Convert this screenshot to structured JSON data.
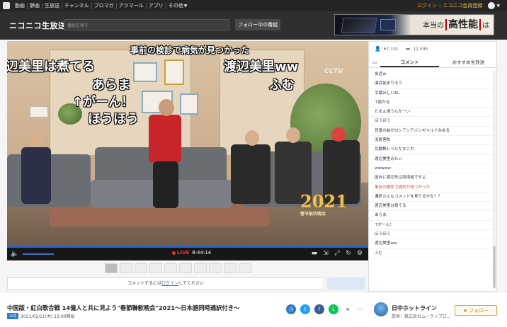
{
  "topnav": {
    "items": [
      "動画",
      "静画",
      "生放送",
      "チャンネル",
      "ブロマガ",
      "アツマール",
      "アプリ",
      "その他"
    ],
    "login": "ログイン",
    "register": "ニコニコ会員登録"
  },
  "header": {
    "brand": "ニコニコ生放送",
    "search_placeholder": "番組を探す",
    "follow_programs": "フォロー中の番組",
    "ad_text_prefix": "本当の",
    "ad_text_big": "高性能",
    "ad_text_suffix": "は"
  },
  "player": {
    "overlay_comments": [
      {
        "text": "事前の検診で病気が見つかった",
        "size": "small"
      },
      {
        "text": "辺美里は煮てる",
        "size": "big"
      },
      {
        "text": "渡辺美里ww",
        "size": "big"
      },
      {
        "text": "あらま",
        "size": "big"
      },
      {
        "text": "ふむ",
        "size": "big"
      },
      {
        "text": "↑がーん！",
        "size": "big"
      },
      {
        "text": "ほうほう",
        "size": "big"
      }
    ],
    "watermark": "CCTV",
    "logo_year": "2021",
    "logo_sub": "春节联欢晚会",
    "live_label": "LIVE",
    "time": "8:44:14",
    "volume_level": 0.55,
    "progress_level": 1.0
  },
  "comment_form": {
    "prefix": "コメントするには",
    "login_link": "ログイン",
    "suffix": "してください"
  },
  "panel": {
    "viewers": "67,101",
    "comments": "11,595",
    "tab_comment": "コメント",
    "tab_recommend": "おすすめ生放送",
    "comments_list": [
      "友近ｗ",
      "演武始まりそう",
      "字幕ほしいね。",
      "↑助かる",
      "たまよ遠うんかーい",
      "ほうほう",
      "背景の絵がロシアンアバンギャルドみある",
      "泡匿害防",
      "北朝鮮レベルだなこれ",
      "渡辺美里みたい",
      "wwwww",
      "因みに渡辺先は渤海省ですよ",
      "事前の検診で病気が見つかった",
      "通訳さんもコメントを見てるかな？？",
      "渡辺美里は煮てる",
      "あらま",
      "↑がーん！",
      "ほうほう",
      "渡辺美里ww",
      "ふむ"
    ],
    "highlight_index": 12
  },
  "footer": {
    "title": "中国版・紅白歌合戦 14億人と共に見よう\"春節聯歓晩会\"2021〜日本語同時通訳付き〜",
    "badge": "公式",
    "date": "2021/02/11(木) 13:00開始",
    "channel_name": "日中ホットライン",
    "channel_provider": "提供：株式会社ムーランプロ...",
    "follow": "フォロー"
  },
  "colors": {
    "accent": "#2f78c4",
    "live": "#e33333",
    "follow_gold": "#c9a24a"
  }
}
